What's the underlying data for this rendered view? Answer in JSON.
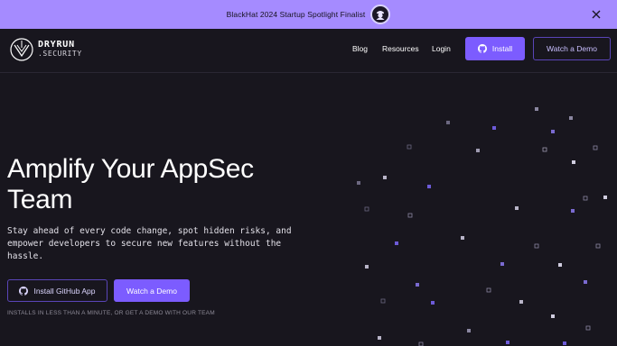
{
  "banner": {
    "text": "BlackHat 2024 Startup Spotlight Finalist",
    "badge_icon": "blackhat-badge-icon",
    "close_icon": "close-icon"
  },
  "nav": {
    "logo": {
      "line1": "DRYRUN",
      "line2": ".SECURITY",
      "icon": "dryrun-logo-icon"
    },
    "links": [
      {
        "label": "Blog"
      },
      {
        "label": "Resources"
      },
      {
        "label": "Login"
      }
    ],
    "install_label": "Install",
    "install_icon": "github-icon",
    "demo_label": "Watch a Demo"
  },
  "hero": {
    "title": "Amplify Your AppSec Team",
    "subtitle": "Stay ahead of every code change, spot hidden risks, and empower developers to secure new features without the hassle.",
    "primary_label": "Install GitHub App",
    "primary_icon": "github-icon",
    "secondary_label": "Watch a Demo",
    "note": "INSTALLS IN LESS THAN A MINUTE, OR GET A DEMO WITH OUR TEAM"
  },
  "colors": {
    "background": "#18161e",
    "banner": "#a58bff",
    "accent": "#7c5cff",
    "outline": "#5a45b8"
  }
}
